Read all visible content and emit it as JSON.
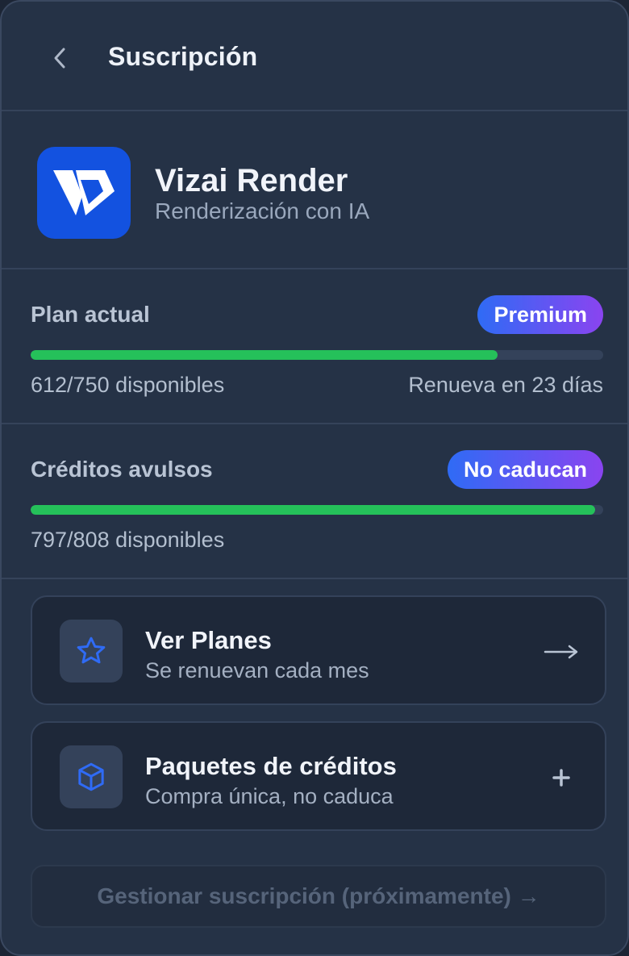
{
  "header": {
    "title": "Suscripción"
  },
  "app": {
    "name": "Vizai Render",
    "subtitle": "Renderización con IA"
  },
  "plan": {
    "title": "Plan actual",
    "badge": "Premium",
    "used": 612,
    "total": 750,
    "fraction": 0.816,
    "available_text": "612/750 disponibles",
    "renew_text": "Renueva en 23 días",
    "bar_color": "#25c15a"
  },
  "credits": {
    "title": "Créditos avulsos",
    "badge": "No caducan",
    "used": 797,
    "total": 808,
    "fraction": 0.986,
    "available_text": "797/808 disponibles",
    "bar_color": "#25c15a"
  },
  "cards": [
    {
      "title": "Ver Planes",
      "subtitle": "Se renuevan cada mes",
      "icon": "star-icon",
      "action_icon": "arrow-right-icon"
    },
    {
      "title": "Paquetes de créditos",
      "subtitle": "Compra única, no caduca",
      "icon": "cube-icon",
      "action_icon": "plus-icon"
    }
  ],
  "manage": {
    "label": "Gestionar suscripción (próximamente) →"
  },
  "colors": {
    "accent": "#2f6bf5",
    "badge_gradient_end": "#8a44f0",
    "logo_bg": "#1352e0",
    "card_icon": "#2f6bf5"
  }
}
